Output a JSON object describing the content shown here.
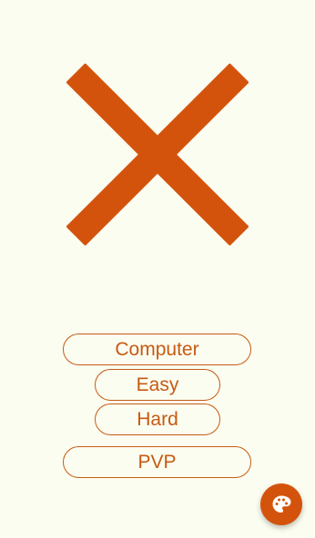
{
  "logo": {
    "icon": "x-mark-icon",
    "color": "#d4530c"
  },
  "menu": {
    "computer_label": "Computer",
    "easy_label": "Easy",
    "hard_label": "Hard",
    "pvp_label": "PVP"
  },
  "fab": {
    "icon": "palette-icon",
    "color": "#d4530c"
  },
  "colors": {
    "background": "#fbfdf0",
    "accent": "#d4530c",
    "outline": "#c75a12"
  }
}
